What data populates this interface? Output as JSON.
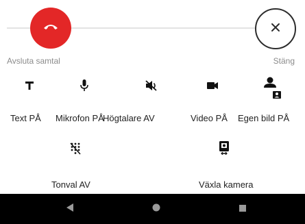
{
  "call": {
    "end_label": "Avsluta samtal",
    "close_label": "Stäng"
  },
  "options": [
    {
      "label": "Text PÅ",
      "icon": "text-icon"
    },
    {
      "label": "Mikrofon PÅ",
      "icon": "microphone-icon"
    },
    {
      "label": "Högtalare AV",
      "icon": "speaker-off-icon"
    },
    {
      "label": "Video PÅ",
      "icon": "video-camera-icon"
    },
    {
      "label": "Egen bild PÅ",
      "icon": "self-view-icon"
    },
    {
      "label": "Tonval AV",
      "icon": "dialpad-off-icon"
    },
    {
      "label": "Växla kamera",
      "icon": "switch-camera-icon"
    }
  ],
  "navbar": {
    "buttons": [
      "back",
      "home",
      "recents"
    ]
  },
  "colors": {
    "end_call": "#e32727",
    "navbar": "#000000",
    "label_gray": "#8b8b8b"
  }
}
